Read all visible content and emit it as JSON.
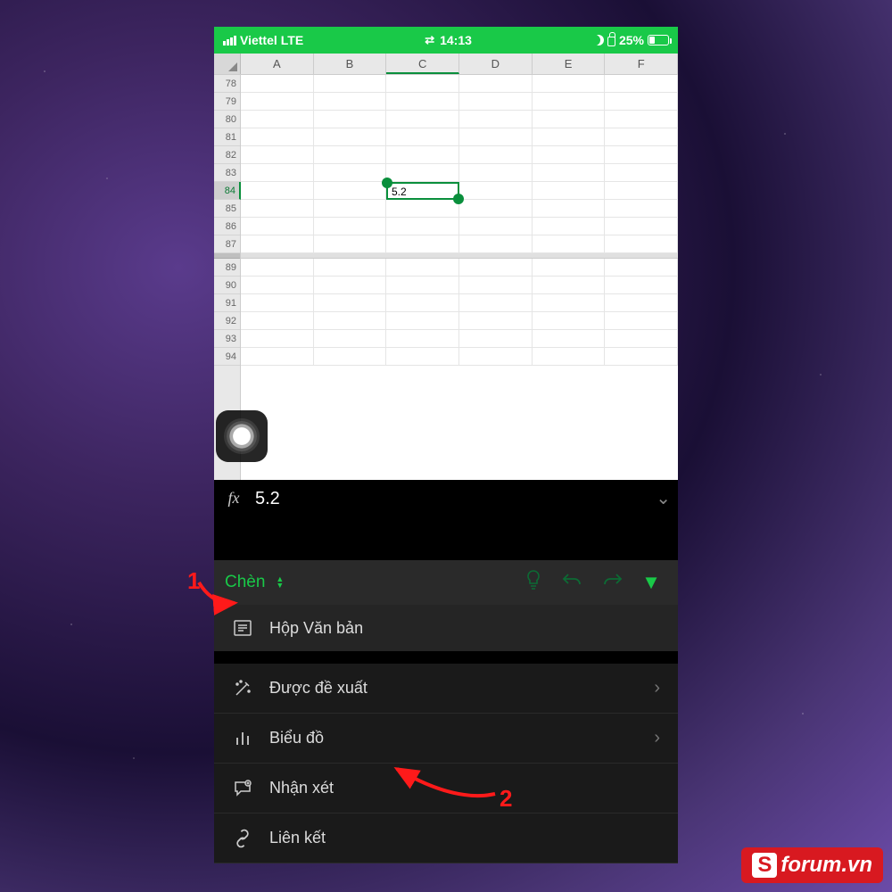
{
  "status": {
    "carrier": "Viettel",
    "network": "LTE",
    "time": "14:13",
    "battery": "25%"
  },
  "sheet": {
    "columns": [
      "A",
      "B",
      "C",
      "D",
      "E",
      "F"
    ],
    "rows_top": [
      "78",
      "79",
      "80",
      "81",
      "82",
      "83",
      "84",
      "85",
      "86",
      "87"
    ],
    "rows_bottom": [
      "89",
      "90",
      "91",
      "92",
      "93",
      "94"
    ],
    "selected_row": "84",
    "selected_col": "C",
    "selected_value": "5.2"
  },
  "formula": {
    "label": "fx",
    "value": "5.2"
  },
  "toolbar": {
    "tab": "Chèn"
  },
  "menu": {
    "textbox": "Hộp Văn bản",
    "suggested": "Được đề xuất",
    "chart": "Biểu đồ",
    "comment": "Nhận xét",
    "link": "Liên kết"
  },
  "annotations": {
    "n1": "1",
    "n2": "2"
  },
  "watermark": {
    "badge": "S",
    "text": "forum.vn"
  }
}
